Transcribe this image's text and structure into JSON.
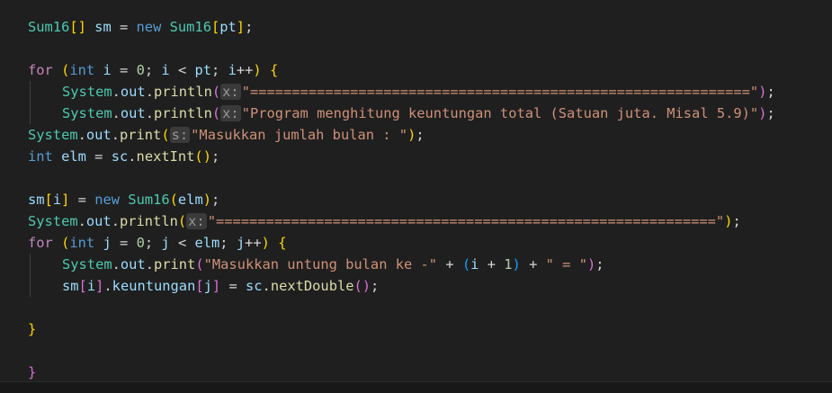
{
  "editor": {
    "lines": [
      [
        [
          "type",
          "Sum16"
        ],
        [
          "b1",
          "[]"
        ],
        [
          "op",
          " "
        ],
        [
          "var",
          "sm"
        ],
        [
          "op",
          " = "
        ],
        [
          "kw",
          "new"
        ],
        [
          "op",
          " "
        ],
        [
          "type",
          "Sum16"
        ],
        [
          "b1",
          "["
        ],
        [
          "var",
          "pt"
        ],
        [
          "b1",
          "]"
        ],
        [
          "op",
          ";"
        ]
      ],
      [],
      [
        [
          "ctl",
          "for"
        ],
        [
          "op",
          " "
        ],
        [
          "b1",
          "("
        ],
        [
          "kw",
          "int"
        ],
        [
          "op",
          " "
        ],
        [
          "var",
          "i"
        ],
        [
          "op",
          " = "
        ],
        [
          "num",
          "0"
        ],
        [
          "op",
          "; "
        ],
        [
          "var",
          "i"
        ],
        [
          "op",
          " < "
        ],
        [
          "var",
          "pt"
        ],
        [
          "op",
          "; "
        ],
        [
          "var",
          "i"
        ],
        [
          "op",
          "++"
        ],
        [
          "b1",
          ")"
        ],
        [
          "op",
          " "
        ],
        [
          "b1",
          "{"
        ]
      ],
      [
        [
          "indent",
          ""
        ],
        [
          "type",
          "System"
        ],
        [
          "op",
          "."
        ],
        [
          "var",
          "out"
        ],
        [
          "op",
          "."
        ],
        [
          "fn",
          "println"
        ],
        [
          "b2",
          "("
        ],
        [
          "hint",
          "x:"
        ],
        [
          "str",
          "\"============================================================\""
        ],
        [
          "b2",
          ")"
        ],
        [
          "op",
          ";"
        ]
      ],
      [
        [
          "indent",
          ""
        ],
        [
          "type",
          "System"
        ],
        [
          "op",
          "."
        ],
        [
          "var",
          "out"
        ],
        [
          "op",
          "."
        ],
        [
          "fn",
          "println"
        ],
        [
          "b2",
          "("
        ],
        [
          "hint",
          "x:"
        ],
        [
          "str",
          "\"Program menghitung keuntungan total (Satuan juta. Misal 5.9)\""
        ],
        [
          "b2",
          ")"
        ],
        [
          "op",
          ";"
        ]
      ],
      [
        [
          "type",
          "System"
        ],
        [
          "op",
          "."
        ],
        [
          "var",
          "out"
        ],
        [
          "op",
          "."
        ],
        [
          "fn",
          "print"
        ],
        [
          "b1",
          "("
        ],
        [
          "hint",
          "s:"
        ],
        [
          "str",
          "\"Masukkan jumlah bulan : \""
        ],
        [
          "b1",
          ")"
        ],
        [
          "op",
          ";"
        ]
      ],
      [
        [
          "kw",
          "int"
        ],
        [
          "op",
          " "
        ],
        [
          "var",
          "elm"
        ],
        [
          "op",
          " = "
        ],
        [
          "var",
          "sc"
        ],
        [
          "op",
          "."
        ],
        [
          "fn",
          "nextInt"
        ],
        [
          "b1",
          "()"
        ],
        [
          "op",
          ";"
        ]
      ],
      [],
      [
        [
          "var",
          "sm"
        ],
        [
          "b1",
          "["
        ],
        [
          "var",
          "i"
        ],
        [
          "b1",
          "]"
        ],
        [
          "op",
          " = "
        ],
        [
          "kw",
          "new"
        ],
        [
          "op",
          " "
        ],
        [
          "type",
          "Sum16"
        ],
        [
          "b1",
          "("
        ],
        [
          "var",
          "elm"
        ],
        [
          "b1",
          ")"
        ],
        [
          "op",
          ";"
        ]
      ],
      [
        [
          "type",
          "System"
        ],
        [
          "op",
          "."
        ],
        [
          "var",
          "out"
        ],
        [
          "op",
          "."
        ],
        [
          "fn",
          "println"
        ],
        [
          "b1",
          "("
        ],
        [
          "hint",
          "x:"
        ],
        [
          "str",
          "\"============================================================\""
        ],
        [
          "b1",
          ")"
        ],
        [
          "op",
          ";"
        ]
      ],
      [
        [
          "ctl",
          "for"
        ],
        [
          "op",
          " "
        ],
        [
          "b1",
          "("
        ],
        [
          "kw",
          "int"
        ],
        [
          "op",
          " "
        ],
        [
          "var",
          "j"
        ],
        [
          "op",
          " = "
        ],
        [
          "num",
          "0"
        ],
        [
          "op",
          "; "
        ],
        [
          "var",
          "j"
        ],
        [
          "op",
          " < "
        ],
        [
          "var",
          "elm"
        ],
        [
          "op",
          "; "
        ],
        [
          "var",
          "j"
        ],
        [
          "op",
          "++"
        ],
        [
          "b1",
          ")"
        ],
        [
          "op",
          " "
        ],
        [
          "b1",
          "{"
        ]
      ],
      [
        [
          "indent",
          ""
        ],
        [
          "type",
          "System"
        ],
        [
          "op",
          "."
        ],
        [
          "var",
          "out"
        ],
        [
          "op",
          "."
        ],
        [
          "fn",
          "print"
        ],
        [
          "b2",
          "("
        ],
        [
          "str",
          "\"Masukkan untung bulan ke -\""
        ],
        [
          "op",
          " + "
        ],
        [
          "b3",
          "("
        ],
        [
          "var",
          "i"
        ],
        [
          "op",
          " + "
        ],
        [
          "num",
          "1"
        ],
        [
          "b3",
          ")"
        ],
        [
          "op",
          " + "
        ],
        [
          "str",
          "\" = \""
        ],
        [
          "b2",
          ")"
        ],
        [
          "op",
          ";"
        ]
      ],
      [
        [
          "indent",
          ""
        ],
        [
          "var",
          "sm"
        ],
        [
          "b2",
          "["
        ],
        [
          "var",
          "i"
        ],
        [
          "b2",
          "]"
        ],
        [
          "op",
          "."
        ],
        [
          "var",
          "keuntungan"
        ],
        [
          "b2",
          "["
        ],
        [
          "var",
          "j"
        ],
        [
          "b2",
          "]"
        ],
        [
          "op",
          " = "
        ],
        [
          "var",
          "sc"
        ],
        [
          "op",
          "."
        ],
        [
          "fn",
          "nextDouble"
        ],
        [
          "b2",
          "()"
        ],
        [
          "op",
          ";"
        ]
      ],
      [],
      [
        [
          "b1",
          "}"
        ]
      ],
      [],
      [
        [
          "b2",
          "}"
        ]
      ]
    ]
  }
}
